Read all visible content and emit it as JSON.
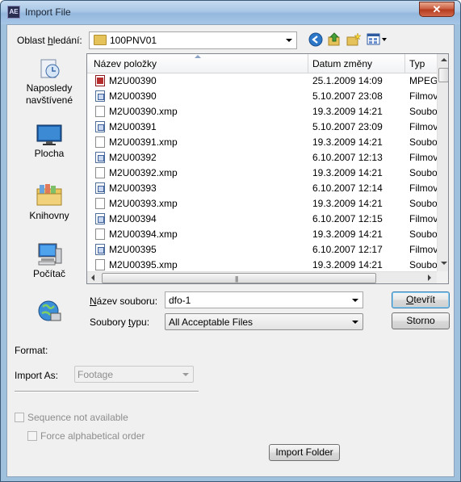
{
  "window": {
    "title": "Import File",
    "app_icon": "AE",
    "close_glyph": "✕"
  },
  "lookin": {
    "label_prefix": "Oblast ",
    "label_underlined": "h",
    "label_suffix": "ledání:",
    "value": "100PNV01"
  },
  "places": [
    {
      "icon": "recent-places-icon",
      "label_line1": "Naposledy",
      "label_line2": "navštívené"
    },
    {
      "icon": "desktop-icon",
      "label_line1": "Plocha",
      "label_line2": ""
    },
    {
      "icon": "libraries-icon",
      "label_line1": "Knihovny",
      "label_line2": ""
    },
    {
      "icon": "computer-icon",
      "label_line1": "Počítač",
      "label_line2": ""
    },
    {
      "icon": "network-icon",
      "label_line1": "",
      "label_line2": ""
    }
  ],
  "columns": {
    "name": "Název položky",
    "date": "Datum změny",
    "type": "Typ"
  },
  "files": [
    {
      "name": "M2U00390",
      "date": "25.1.2009 14:09",
      "type": "MPEG-",
      "icon": "mpg"
    },
    {
      "name": "M2U00390",
      "date": "5.10.2007 23:08",
      "type": "Filmov",
      "icon": "mov"
    },
    {
      "name": "M2U00390.xmp",
      "date": "19.3.2009 14:21",
      "type": "Soubo",
      "icon": "doc"
    },
    {
      "name": "M2U00391",
      "date": "5.10.2007 23:09",
      "type": "Filmov",
      "icon": "mov"
    },
    {
      "name": "M2U00391.xmp",
      "date": "19.3.2009 14:21",
      "type": "Soubo",
      "icon": "doc"
    },
    {
      "name": "M2U00392",
      "date": "6.10.2007 12:13",
      "type": "Filmov",
      "icon": "mov"
    },
    {
      "name": "M2U00392.xmp",
      "date": "19.3.2009 14:21",
      "type": "Soubo",
      "icon": "doc"
    },
    {
      "name": "M2U00393",
      "date": "6.10.2007 12:14",
      "type": "Filmov",
      "icon": "mov"
    },
    {
      "name": "M2U00393.xmp",
      "date": "19.3.2009 14:21",
      "type": "Soubo",
      "icon": "doc"
    },
    {
      "name": "M2U00394",
      "date": "6.10.2007 12:15",
      "type": "Filmov",
      "icon": "mov"
    },
    {
      "name": "M2U00394.xmp",
      "date": "19.3.2009 14:21",
      "type": "Soubo",
      "icon": "doc"
    },
    {
      "name": "M2U00395",
      "date": "6.10.2007 12:17",
      "type": "Filmov",
      "icon": "mov"
    },
    {
      "name": "M2U00395.xmp",
      "date": "19.3.2009 14:21",
      "type": "Soubo",
      "icon": "doc"
    }
  ],
  "filename": {
    "label_underlined": "N",
    "label_rest": "ázev souboru:",
    "value": "dfo-1"
  },
  "filetype": {
    "label_prefix": "Soubory ",
    "label_underlined": "t",
    "label_suffix": "ypu:",
    "value": "All Acceptable Files"
  },
  "buttons": {
    "open_underlined": "O",
    "open_rest": "tevřít",
    "cancel": "Storno",
    "import_folder": "Import Folder"
  },
  "format": {
    "label": "Format:"
  },
  "import_as": {
    "label": "Import As:",
    "value": "Footage"
  },
  "options": {
    "sequence": "Sequence not available",
    "alphabetical": "Force alphabetical order"
  }
}
